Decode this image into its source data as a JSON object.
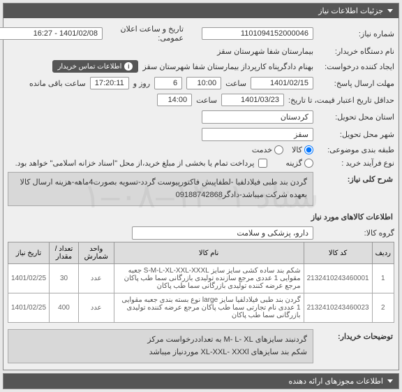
{
  "header": {
    "title": "جزئیات اطلاعات نیاز"
  },
  "fields": {
    "need_no_label": "شماره نیاز:",
    "need_no": "1101094152000046",
    "announce_label": "تاریخ و ساعت اعلان عمومی:",
    "announce": "1401/02/08 - 16:27",
    "buyer_org_label": "نام دستگاه خریدار:",
    "buyer_org": "بیمارستان شفا شهرستان سقز",
    "requester_label": "ایجاد کننده درخواست:",
    "requester": "بهنام دادگرپناه کارپرداز بیمارستان شفا شهرستان سقز",
    "contact_btn": "اطلاعات تماس خریدار",
    "deadline_label": "مهلت ارسال پاسخ:",
    "deadline_date": "1401/02/15",
    "time_label": "ساعت",
    "deadline_time": "10:00",
    "day_label": "روز و",
    "days_remain": "6",
    "hours_remain_label": "ساعت باقی مانده",
    "hours_remain": "17:20:11",
    "validity_label": "حداقل تاریخ اعتبار قیمت، تا تاریخ:",
    "validity_date": "1401/03/23",
    "validity_time": "14:00",
    "province_label": "استان محل تحویل:",
    "province": "کردستان",
    "city_label": "شهر محل تحویل:",
    "city": "سقز",
    "package_label": "طبقه بندی موضوعی:",
    "pkg_good": "کالا",
    "pkg_service": "خدمت",
    "process_label": "نوع فرآیند خرید :",
    "proc_tender": "گزینه",
    "payment_note": "پرداخت تمام یا بخشی از مبلغ خرید،از محل \"اسناد خزانه اسلامی\" خواهد بود.",
    "summary_label": "شرح کلی نیاز:",
    "summary": "گردن بند طبی فیلادلفیا -لطفاپیش فاکتورپیوست گردد-تسویه بصورت4ماهه-هزینه ارسال کالا بعهده شرکت میباشد-دادگر09188742868",
    "goods_section": "اطلاعات کالاهای مورد نیاز",
    "goods_group_label": "گروه کالا:",
    "goods_group": "دارو، پزشکی و سلامت"
  },
  "table": {
    "headers": [
      "ردیف",
      "کد کالا",
      "نام کالا",
      "واحد شمارش",
      "تعداد / مقدار",
      "تاریخ نیاز"
    ],
    "rows": [
      {
        "idx": "1",
        "code": "2132410243460001",
        "name": "شکم بند ساده کشی سایز سایز S-M-L-XL-XXL-XXXL جعبه مقوایی 1 عددی مرجع سازنده تولیدی بازرگانی سما طب پاکان مرجع عرضه کننده تولیدی بازرگانی سما طب پاکان",
        "unit": "عدد",
        "qty": "30",
        "date": "1401/02/25"
      },
      {
        "idx": "2",
        "code": "2132410243460023",
        "name": "گردن بند طبی فیلادلفیا سایز large نوع بسته بندی جعبه مقوایی 1 عددی نام تجارتی سما طب پاکان مرجع عرضه کننده تولیدی بازرگانی سما طب پاکان",
        "unit": "عدد",
        "qty": "400",
        "date": "1401/02/25"
      }
    ]
  },
  "notes": {
    "label": "توضیحات خریدار:",
    "text": "گردنبند سایزهای M- L- XL به تعداددرخواست مرکز\nشکم بند سایزهای XL-XXL-  XXXl موردنیاز میباشد"
  },
  "footer": {
    "title": "اطلاعات مجوزهای ارائه دهنده"
  }
}
